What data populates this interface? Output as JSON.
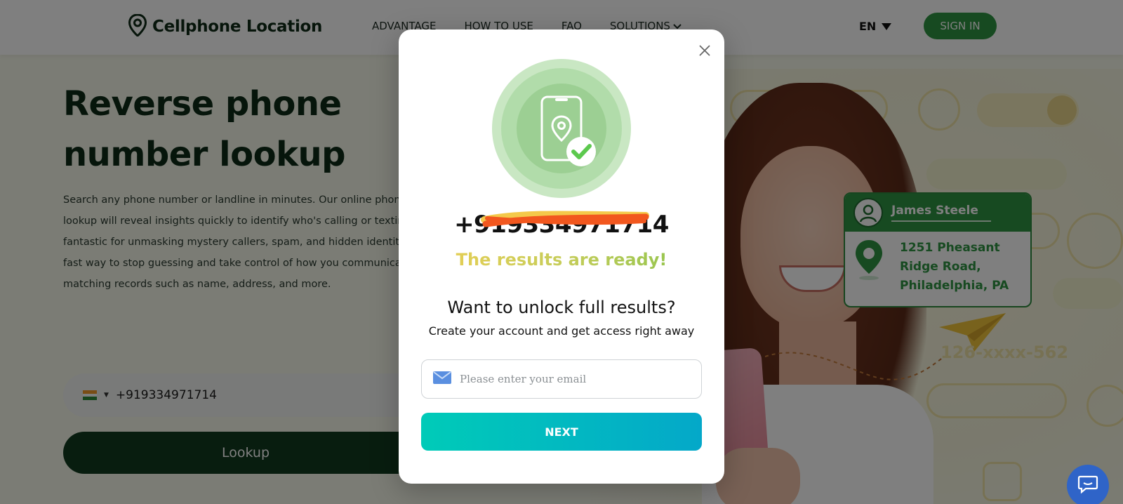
{
  "header": {
    "brand": "Cellphone Location",
    "nav": [
      "ADVANTAGE",
      "HOW TO USE",
      "FAQ",
      "SOLUTIONS"
    ],
    "lang": "EN",
    "signin": "SIGN IN"
  },
  "hero": {
    "title_line1": "Reverse phone",
    "title_line2": "number lookup",
    "desc_lines": [
      "Search any phone number or landline in minutes. Our online phone n",
      "lookup will reveal insights quickly to identify who's calling or texting yo",
      "fantastic for unmasking mystery callers, spam, and hidden identities.",
      "fast way to stop guessing and take control of how you communicate",
      "matching records such as name, address, and more."
    ],
    "phone_value": "+919334971714",
    "lookup_label": "Lookup"
  },
  "card": {
    "name": "James Steele",
    "address_lines": [
      "1251 Pheasant",
      "Ridge Road,",
      "Philadelphia, PA"
    ],
    "masked_number": "126-xxxx-562"
  },
  "modal": {
    "phone": "+919334971714",
    "ready": "The results are ready!",
    "unlock": "Want to unlock full results?",
    "create": "Create your account and get access right away",
    "email_placeholder": "Please enter your email",
    "next_label": "NEXT"
  },
  "colors": {
    "brand_green": "#2f9442",
    "dark_green": "#113a1e",
    "next_gradient_start": "#00cbb8",
    "next_gradient_end": "#04a8c9"
  }
}
